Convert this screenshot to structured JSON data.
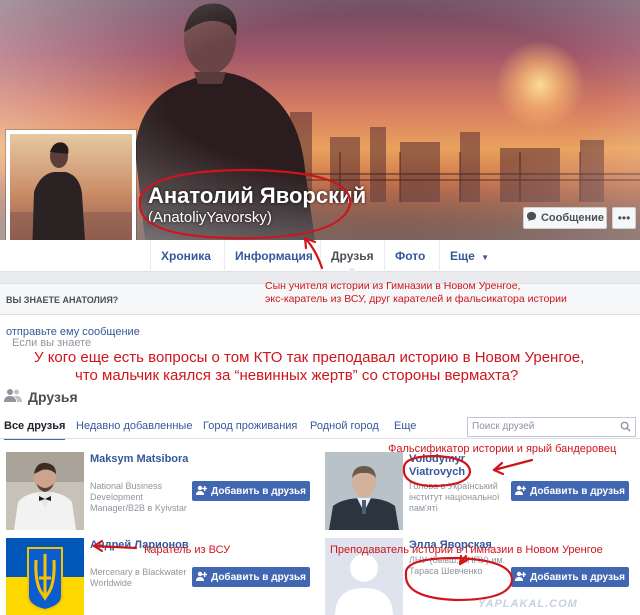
{
  "profile": {
    "name": "Анатолий Яворский",
    "handle": "(AnatoliyYavorsky)",
    "message_button": "Сообщение",
    "more_button": "•••"
  },
  "nav": {
    "items": [
      {
        "label": "Хроника",
        "active": false
      },
      {
        "label": "Информация",
        "active": false
      },
      {
        "label": "Друзья",
        "active": true
      },
      {
        "label": "Фото",
        "active": false
      },
      {
        "label": "Еще",
        "active": false
      }
    ]
  },
  "know": {
    "heading": "ВЫ ЗНАЕТЕ АНАТОЛИЯ?",
    "text_before": "Если вы знаете Анатолия, ",
    "link": "отправьте ему сообщение",
    "text_after": "."
  },
  "friends": {
    "title": "Друзья",
    "tabs": [
      {
        "label": "Все друзья",
        "active": true
      },
      {
        "label": "Недавно добавленные",
        "active": false
      },
      {
        "label": "Город проживания",
        "active": false
      },
      {
        "label": "Родной город",
        "active": false
      },
      {
        "label": "Еще",
        "active": false
      }
    ],
    "search_placeholder": "Поиск друзей",
    "add_label": "Добавить в друзья",
    "cards": [
      {
        "name": "Maksym Matsibora",
        "desc": "National Business Development Manager/B2B в Kyivstar"
      },
      {
        "name": "Volodymyr Viatrovych",
        "desc": "Голова в Український інститут національної пам'яті"
      },
      {
        "name": "Андрей Ларионов",
        "desc": "Mercenary в Blackwater Worldwide"
      },
      {
        "name": "Элла Яворская",
        "desc": "ЛНУ (бывш. ЛНПУ) им. Тараса Шевченко"
      }
    ]
  },
  "annotations": {
    "caption_1_line1": "Сын учителя истории из Гимназии в Новом Уренгое,",
    "caption_1_line2": "экс-каратель из ВСУ, друг карателей и фальсикатора истории",
    "question_line1": "У кого еще есть вопросы о том КТО так преподавал историю в Новом Уренгое,",
    "question_line2": "что мальчик каялся за “невинных жертв” со стороны вермахта?",
    "note_viatrovych": "Фальсификатор истории и ярый бандеровец",
    "note_larionov": "Каратель из ВСУ",
    "note_ella": "Преподаватель истории в Гимназии в Новом Уренгое"
  },
  "watermark": "YAPLAKAL.COM",
  "colors": {
    "link": "#365899",
    "button": "#4267b2",
    "annotation": "#d0141c"
  }
}
